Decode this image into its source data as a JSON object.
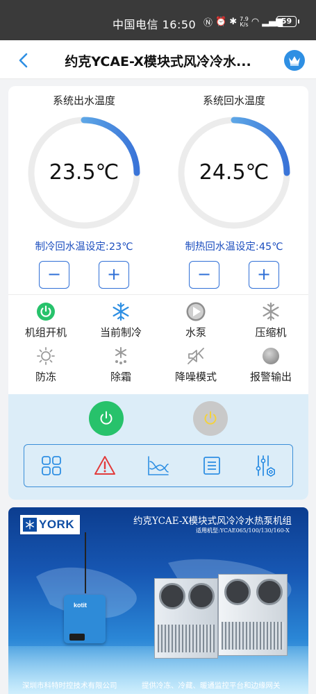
{
  "statusbar": {
    "text": "中国电信 16:50",
    "net_speed_top": "7.9",
    "net_speed_bottom": "K/s",
    "battery": "59"
  },
  "header": {
    "title": "约克YCAE-X模块式风冷冷水..."
  },
  "gauges": [
    {
      "title": "系统出水温度",
      "value": "23.5℃",
      "level": 0.25,
      "setpoint": "制冷回水温设定:23℃",
      "minus": "−",
      "plus": "+"
    },
    {
      "title": "系统回水温度",
      "value": "24.5℃",
      "level": 0.25,
      "setpoint": "制热回水温设定:45℃",
      "minus": "−",
      "plus": "+"
    }
  ],
  "status_items": [
    {
      "label": "机组开机",
      "icon": "power-on-icon"
    },
    {
      "label": "当前制冷",
      "icon": "snowflake-icon"
    },
    {
      "label": "水泵",
      "icon": "pump-play-icon"
    },
    {
      "label": "压缩机",
      "icon": "compressor-snowflake-icon"
    },
    {
      "label": "防冻",
      "icon": "sun-antifreeze-icon"
    },
    {
      "label": "除霜",
      "icon": "defrost-icon"
    },
    {
      "label": "降噪模式",
      "icon": "mute-speaker-icon"
    },
    {
      "label": "报警输出",
      "icon": "alarm-dot-icon"
    }
  ],
  "controls": {
    "power_on_color": "#27c26b",
    "power_off_color": "#c9c9c9",
    "tools": [
      "grid-icon",
      "warning-icon",
      "chart-icon",
      "list-icon",
      "settings-sliders-icon"
    ]
  },
  "colors": {
    "accent": "#2e8fe3",
    "gauge_track": "#ececec",
    "gauge_start": "#7fd6f3",
    "gauge_end": "#3a74d8",
    "setpoint_text": "#1d4fbf",
    "alarm": "#e23b3b"
  },
  "banner": {
    "logo": "YORK",
    "title": "约克YCAE-X模块式风冷冷水热泵机组",
    "subtitle": "适用机型:YCAE065/100/130/160-X",
    "footer_left": "深圳市科特时控技术有限公司",
    "footer_right": "提供冷冻、冷藏、暖通监控平台和边缘网关",
    "gateway_brand": "kotit"
  }
}
